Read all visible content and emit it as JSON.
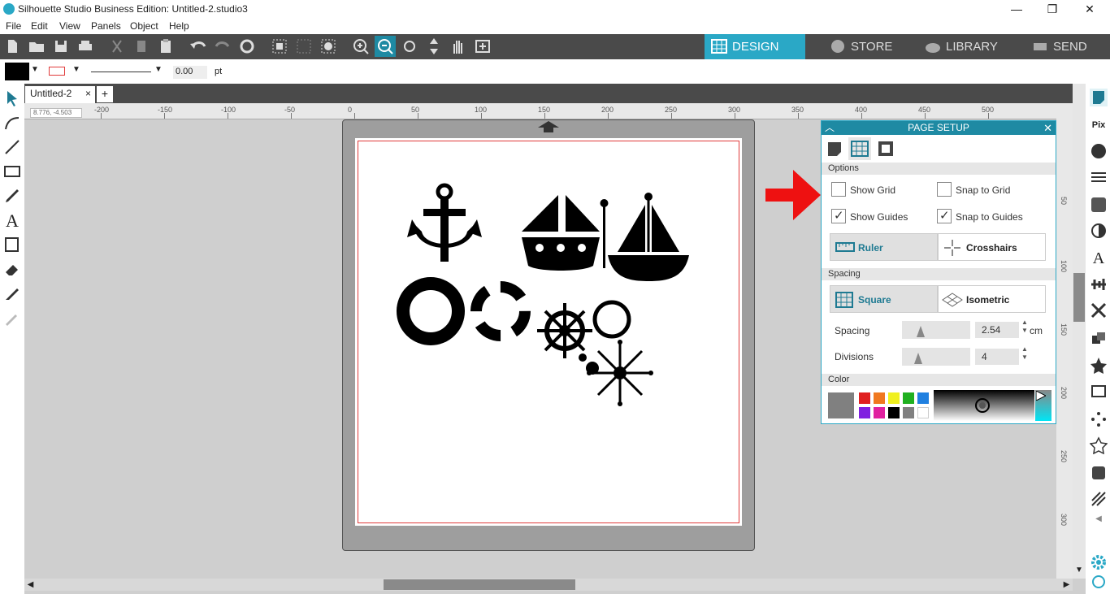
{
  "window": {
    "title": "Silhouette Studio Business Edition: Untitled-2.studio3"
  },
  "menu": [
    "File",
    "Edit",
    "View",
    "Panels",
    "Object",
    "Help"
  ],
  "nav_tabs": [
    "DESIGN",
    "STORE",
    "LIBRARY",
    "SEND"
  ],
  "props": {
    "line_width": "0.00",
    "unit": "pt"
  },
  "document_tab": {
    "name": "Untitled-2",
    "close": "×",
    "add": "+"
  },
  "cursor_readout": "8.776, -4.503",
  "ruler": {
    "h_ticks": [
      "-200",
      "-150",
      "-100",
      "-50",
      "0",
      "50",
      "100",
      "150",
      "200",
      "250",
      "300",
      "350",
      "400",
      "450",
      "500"
    ],
    "v_ticks": [
      "50",
      "100",
      "150",
      "200",
      "250",
      "300"
    ]
  },
  "page_setup": {
    "title": "PAGE SETUP",
    "options_header": "Options",
    "show_grid": {
      "label": "Show Grid",
      "checked": false
    },
    "snap_to_grid": {
      "label": "Snap to Grid",
      "checked": false
    },
    "show_guides": {
      "label": "Show Guides",
      "checked": true
    },
    "snap_to_guides": {
      "label": "Snap to Guides",
      "checked": true
    },
    "ruler_label": "Ruler",
    "crosshairs_label": "Crosshairs",
    "spacing_header": "Spacing",
    "square_label": "Square",
    "isometric_label": "Isometric",
    "spacing_label": "Spacing",
    "spacing_value": "2.54",
    "spacing_unit": "cm",
    "divisions_label": "Divisions",
    "divisions_value": "4",
    "color_header": "Color",
    "swatches": [
      "#e02020",
      "#f07820",
      "#f0f020",
      "#20b020",
      "#2080e0",
      "#8020e0",
      "#e020a0",
      "#000000",
      "#808080",
      "#ffffff"
    ],
    "selected_color": "#808080"
  },
  "accent": "#2aa8c6"
}
